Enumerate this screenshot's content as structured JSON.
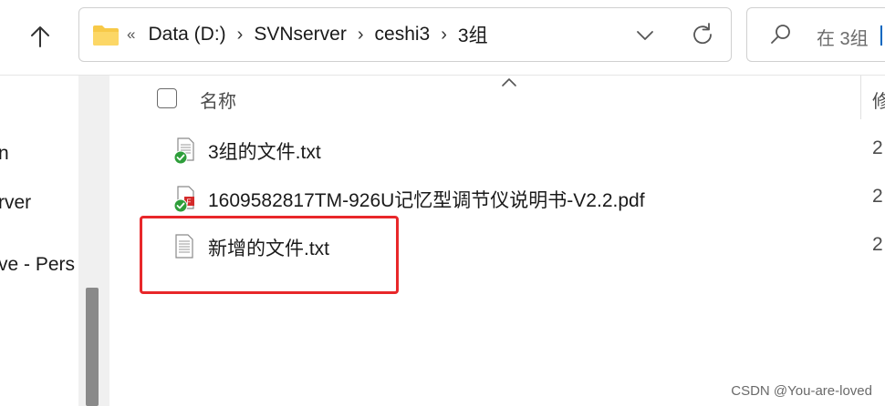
{
  "toolbar": {
    "up_icon": "arrow-up-icon",
    "breadcrumb_lead": "«",
    "breadcrumb": [
      "Data (D:)",
      "SVNserver",
      "ceshi3",
      "3组"
    ],
    "search_placeholder": "在 3组 "
  },
  "nav": {
    "items": [
      "n",
      "rver",
      "ve - Pers"
    ]
  },
  "list": {
    "header_name": "名称",
    "header_date": "修",
    "files": [
      {
        "name": "3组的文件.txt",
        "date": "2",
        "icon": "svn-normal-txt-icon"
      },
      {
        "name": "1609582817TM-926U记忆型调节仪说明书-V2.2.pdf",
        "date": "2",
        "icon": "svn-normal-pdf-icon"
      },
      {
        "name": "新增的文件.txt",
        "date": "2",
        "icon": "unversioned-txt-icon"
      }
    ]
  },
  "annotation_color": "#e8272a",
  "watermark": "CSDN @You-are-loved"
}
